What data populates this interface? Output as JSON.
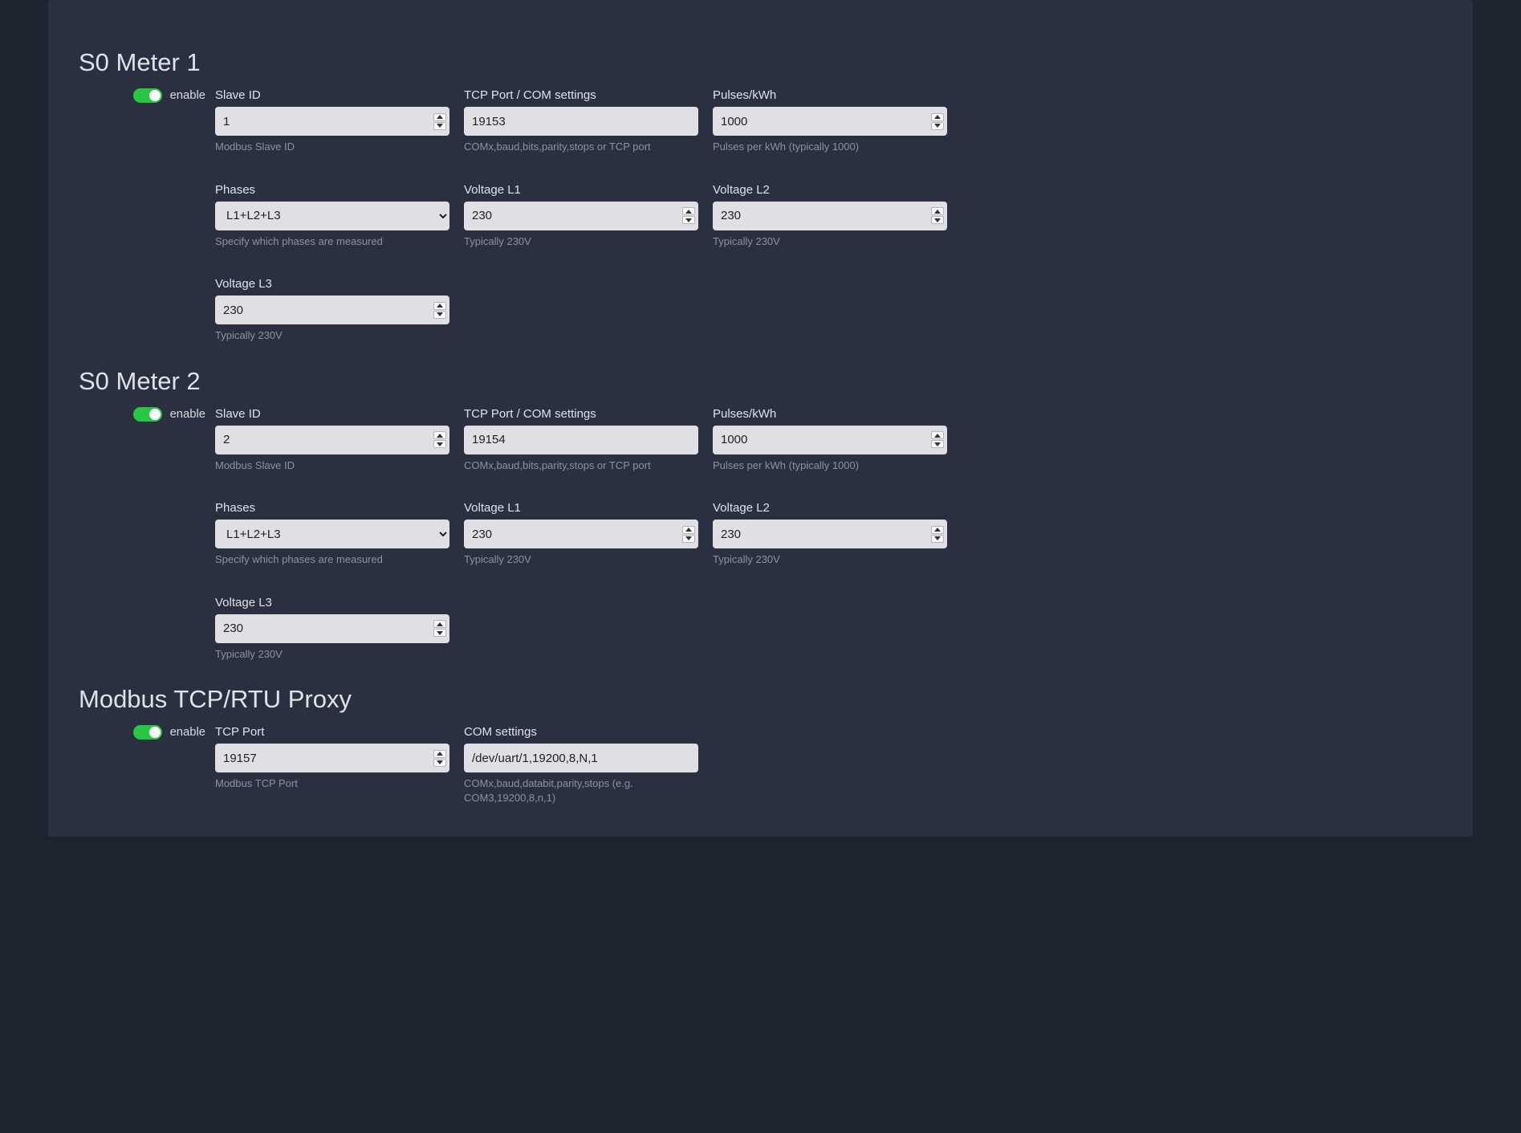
{
  "enable_label": "enable",
  "sections": {
    "meter1": {
      "title": "S0 Meter 1",
      "enabled": true,
      "slave_id": {
        "label": "Slave ID",
        "value": "1",
        "help": "Modbus Slave ID"
      },
      "tcp": {
        "label": "TCP Port / COM settings",
        "value": "19153",
        "help": "COMx,baud,bits,parity,stops or TCP port"
      },
      "pulses": {
        "label": "Pulses/kWh",
        "value": "1000",
        "help": "Pulses per kWh (typically 1000)"
      },
      "phases": {
        "label": "Phases",
        "value": "L1+L2+L3",
        "help": "Specify which phases are measured"
      },
      "vl1": {
        "label": "Voltage L1",
        "value": "230",
        "help": "Typically 230V"
      },
      "vl2": {
        "label": "Voltage L2",
        "value": "230",
        "help": "Typically 230V"
      },
      "vl3": {
        "label": "Voltage L3",
        "value": "230",
        "help": "Typically 230V"
      }
    },
    "meter2": {
      "title": "S0 Meter 2",
      "enabled": true,
      "slave_id": {
        "label": "Slave ID",
        "value": "2",
        "help": "Modbus Slave ID"
      },
      "tcp": {
        "label": "TCP Port / COM settings",
        "value": "19154",
        "help": "COMx,baud,bits,parity,stops or TCP port"
      },
      "pulses": {
        "label": "Pulses/kWh",
        "value": "1000",
        "help": "Pulses per kWh (typically 1000)"
      },
      "phases": {
        "label": "Phases",
        "value": "L1+L2+L3",
        "help": "Specify which phases are measured"
      },
      "vl1": {
        "label": "Voltage L1",
        "value": "230",
        "help": "Typically 230V"
      },
      "vl2": {
        "label": "Voltage L2",
        "value": "230",
        "help": "Typically 230V"
      },
      "vl3": {
        "label": "Voltage L3",
        "value": "230",
        "help": "Typically 230V"
      }
    },
    "proxy": {
      "title": "Modbus TCP/RTU Proxy",
      "enabled": true,
      "port": {
        "label": "TCP Port",
        "value": "19157",
        "help": "Modbus TCP Port"
      },
      "com": {
        "label": "COM settings",
        "value": "/dev/uart/1,19200,8,N,1",
        "help": "COMx,baud,databit,parity,stops (e.g. COM3,19200,8,n,1)"
      }
    }
  }
}
